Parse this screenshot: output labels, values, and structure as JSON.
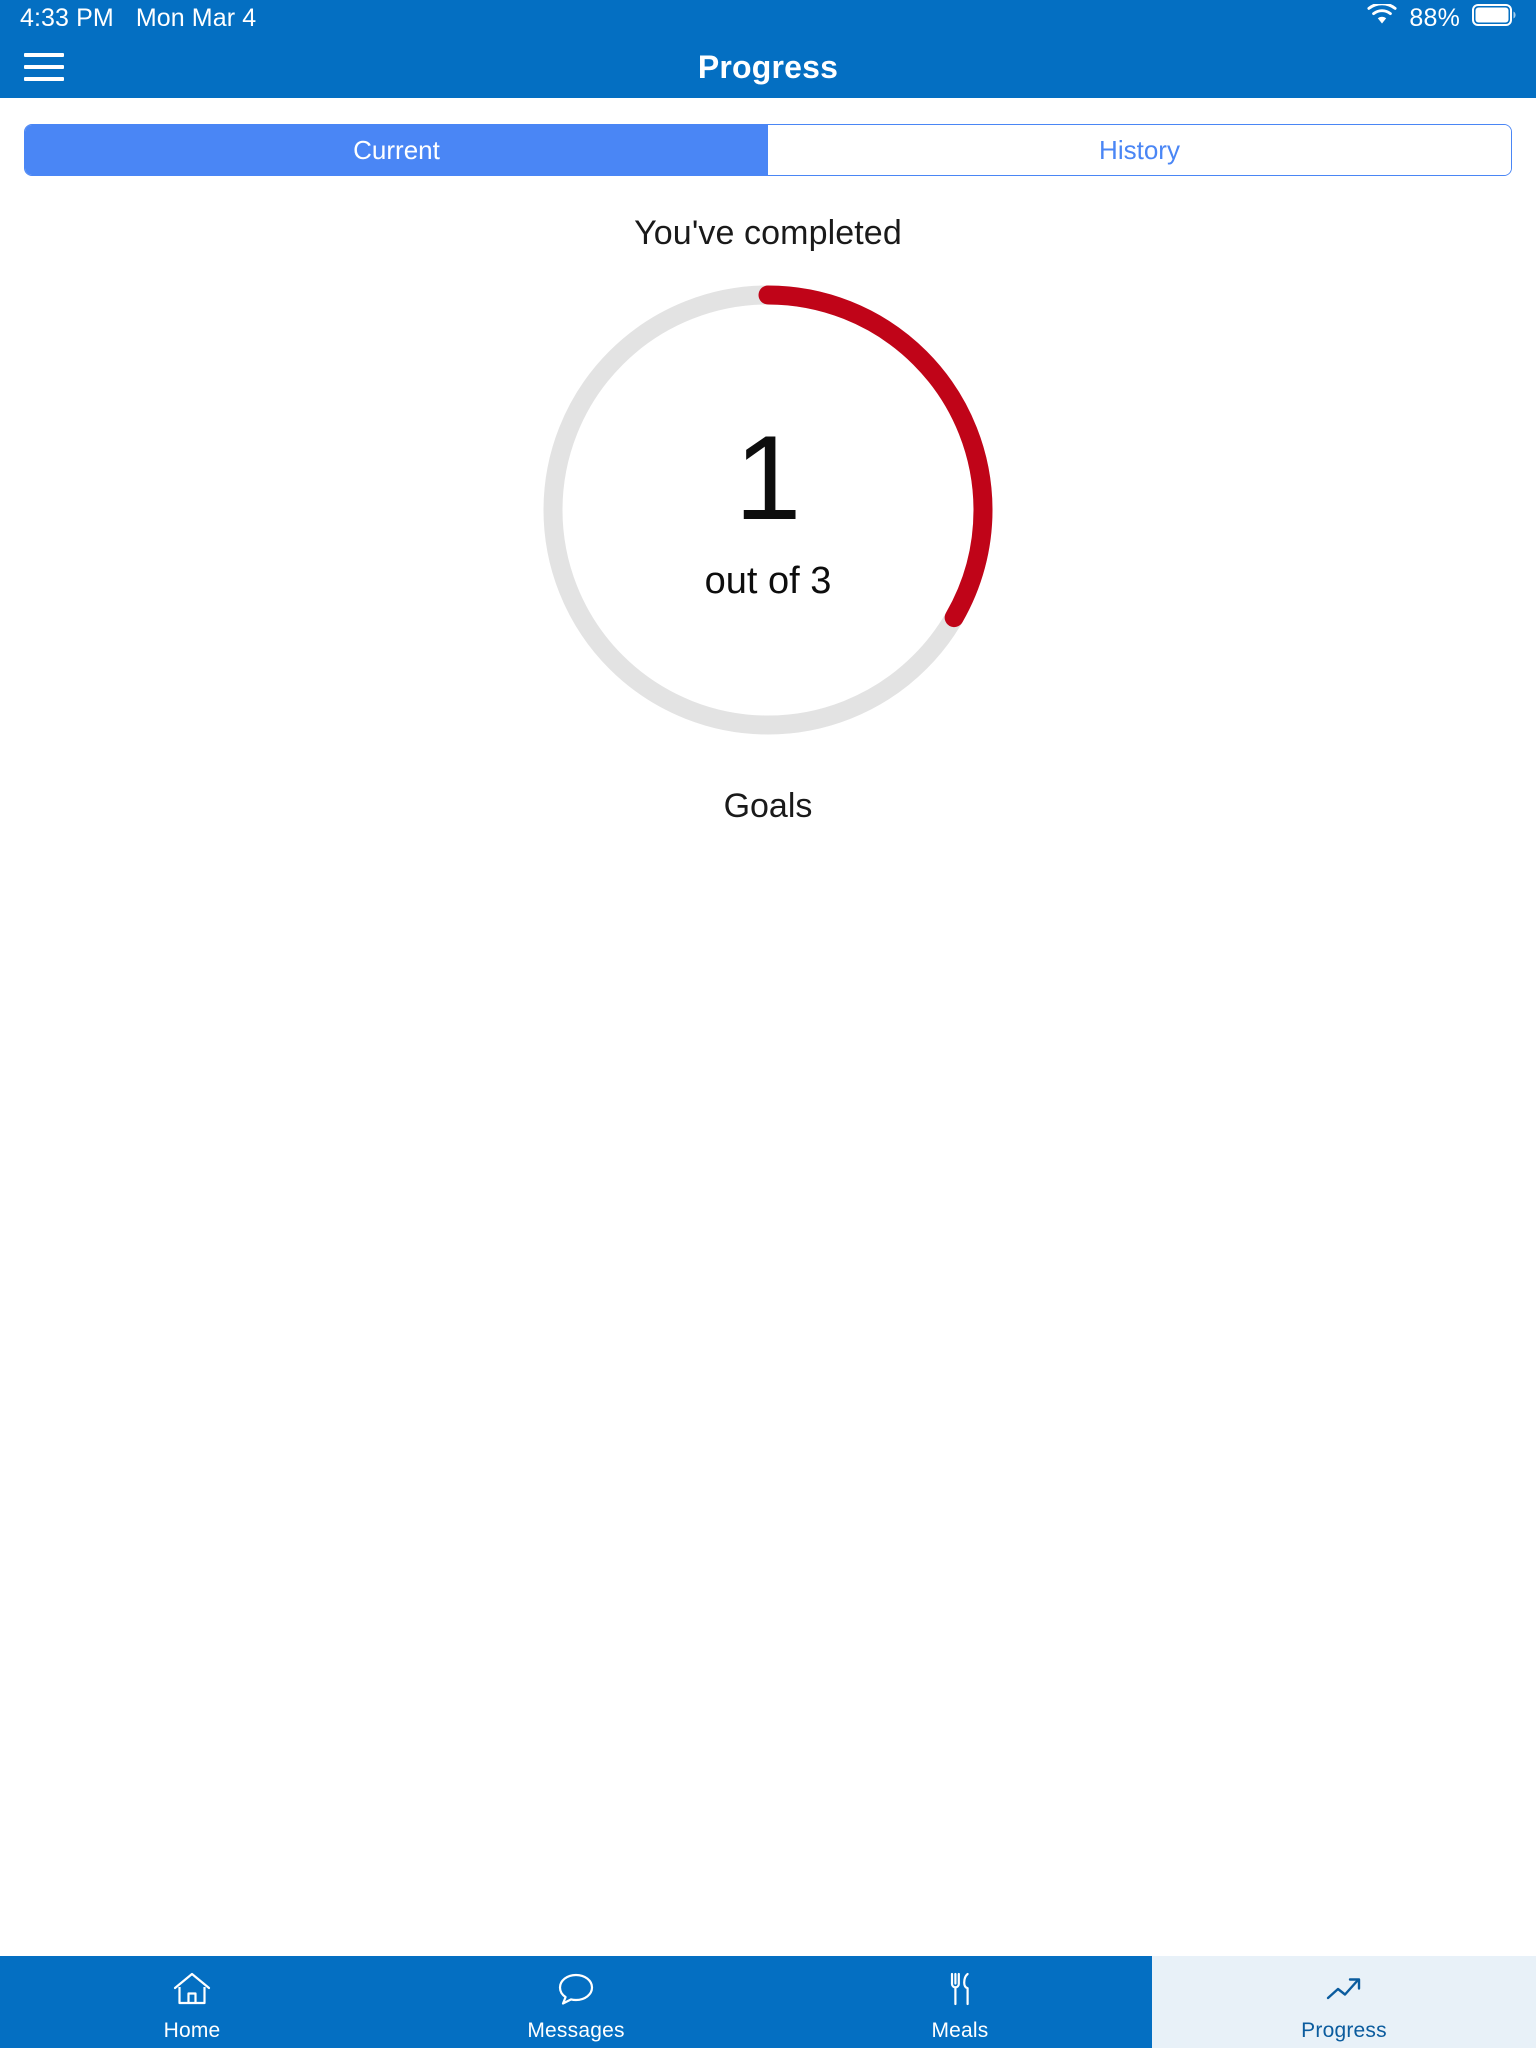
{
  "status_bar": {
    "time": "4:33 PM",
    "date": "Mon Mar 4",
    "battery_percent": "88%",
    "wifi_icon": "wifi-icon",
    "battery_icon": "battery-icon"
  },
  "nav_bar": {
    "title": "Progress",
    "menu_icon": "hamburger-menu-icon"
  },
  "segmented_control": {
    "tabs": [
      {
        "label": "Current",
        "active": true
      },
      {
        "label": "History",
        "active": false
      }
    ]
  },
  "progress": {
    "headline": "You've completed",
    "value": "1",
    "sub": "out of 3",
    "caption": "Goals",
    "completed": 1,
    "total": 3,
    "arc_color": "#c00418",
    "track_color": "#e3e3e3"
  },
  "tab_bar": {
    "items": [
      {
        "label": "Home",
        "icon": "home-icon",
        "selected": false
      },
      {
        "label": "Messages",
        "icon": "chat-bubble-icon",
        "selected": false
      },
      {
        "label": "Meals",
        "icon": "fork-knife-icon",
        "selected": false
      },
      {
        "label": "Progress",
        "icon": "trending-up-icon",
        "selected": true
      }
    ]
  },
  "colors": {
    "header_blue": "#046fc2",
    "accent_blue": "#4a86f5",
    "selected_tab_bg": "#e8f1f8"
  }
}
